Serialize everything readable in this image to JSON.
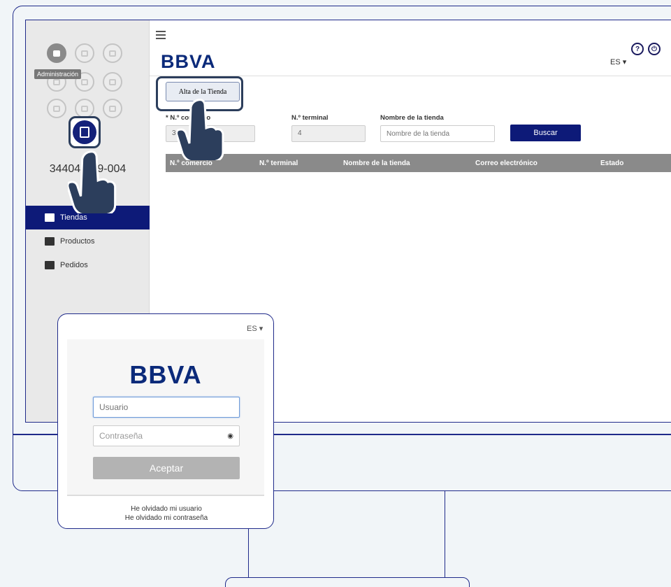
{
  "sidebar": {
    "tooltip": "Administración",
    "merchant_id": "344047  69-004",
    "role": "Ad",
    "items": [
      {
        "label": "Tiendas",
        "icon": "store-icon",
        "active": true
      },
      {
        "label": "Productos",
        "icon": "bag-icon",
        "active": false
      },
      {
        "label": "Pedidos",
        "icon": "cart-icon",
        "active": false
      }
    ]
  },
  "header": {
    "logo": "BBVA",
    "lang": "ES ▾",
    "help": "?",
    "power": "⏻"
  },
  "main": {
    "alta_label": "Alta de la Tienda",
    "fields": {
      "comercio_label": "* N.º comercio",
      "comercio_value": "3",
      "terminal_label": "N.º terminal",
      "terminal_value": "4",
      "nombre_label": "Nombre de la tienda",
      "nombre_placeholder": "Nombre de la tienda"
    },
    "buscar_label": "Buscar",
    "table_headers": [
      "N.º comercio",
      "N.º terminal",
      "Nombre de la tienda",
      "Correo electrónico",
      "Estado"
    ]
  },
  "login": {
    "lang": "ES ▾",
    "logo": "BBVA",
    "user_placeholder": "Usuario",
    "password_placeholder": "Contraseña",
    "submit_label": "Aceptar",
    "forgot_user": "He olvidado mi usuario",
    "forgot_password": "He olvidado mi contraseña"
  },
  "colors": {
    "brand_navy": "#0d1a78",
    "outline": "#1f2a8a",
    "background": "#f1f5f8"
  }
}
